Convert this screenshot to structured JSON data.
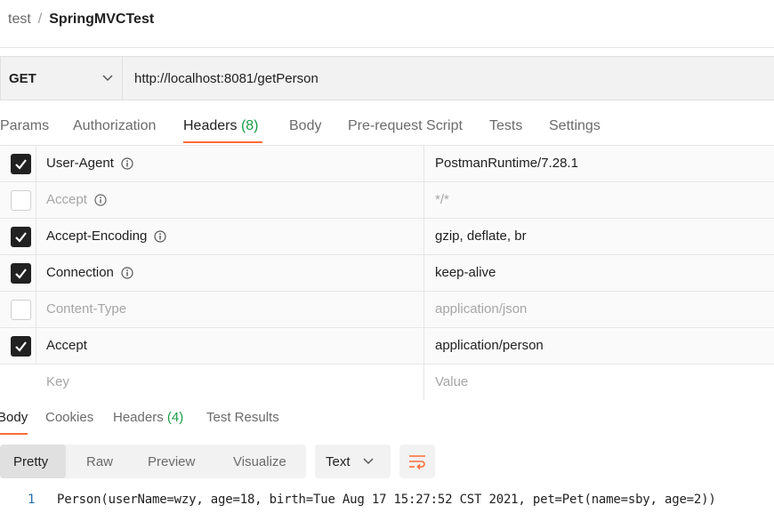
{
  "breadcrumb": {
    "parent": "test",
    "separator": "/",
    "current": "SpringMVCTest"
  },
  "request": {
    "method": "GET",
    "url": "http://localhost:8081/getPerson"
  },
  "request_tabs": [
    {
      "label": "Params"
    },
    {
      "label": "Authorization"
    },
    {
      "label": "Headers",
      "count": "(8)",
      "active": true
    },
    {
      "label": "Body"
    },
    {
      "label": "Pre-request Script"
    },
    {
      "label": "Tests"
    },
    {
      "label": "Settings"
    }
  ],
  "headers": [
    {
      "checked": true,
      "key": "User-Agent",
      "info": true,
      "value": "PostmanRuntime/7.28.1"
    },
    {
      "checked": false,
      "key": "Accept",
      "info": true,
      "value": "*/*"
    },
    {
      "checked": true,
      "key": "Accept-Encoding",
      "info": true,
      "value": "gzip, deflate, br"
    },
    {
      "checked": true,
      "key": "Connection",
      "info": true,
      "value": "keep-alive"
    },
    {
      "checked": false,
      "key": "Content-Type",
      "info": false,
      "value": "application/json"
    },
    {
      "checked": true,
      "key": "Accept",
      "info": false,
      "value": "application/person"
    }
  ],
  "new_header": {
    "key_placeholder": "Key",
    "value_placeholder": "Value"
  },
  "response_tabs": [
    {
      "label": "Body",
      "active": true
    },
    {
      "label": "Cookies"
    },
    {
      "label": "Headers",
      "count": "(4)"
    },
    {
      "label": "Test Results"
    }
  ],
  "body_view": {
    "modes": [
      "Pretty",
      "Raw",
      "Preview",
      "Visualize"
    ],
    "active": "Pretty",
    "format": "Text"
  },
  "response_body": [
    {
      "line": "1",
      "text": "Person(userName=wzy, age=18, birth=Tue Aug 17 15:27:52 CST 2021, pet=Pet(name=sby, age=2))"
    }
  ],
  "colors": {
    "accent": "#ff6c37",
    "count_green": "#1a9c46",
    "line_number_blue": "#1f6fb2"
  },
  "icons": {
    "method_dropdown": "chevron-down-icon",
    "info": "info-circle-icon",
    "checkbox": "check-icon",
    "wrap": "word-wrap-icon"
  }
}
